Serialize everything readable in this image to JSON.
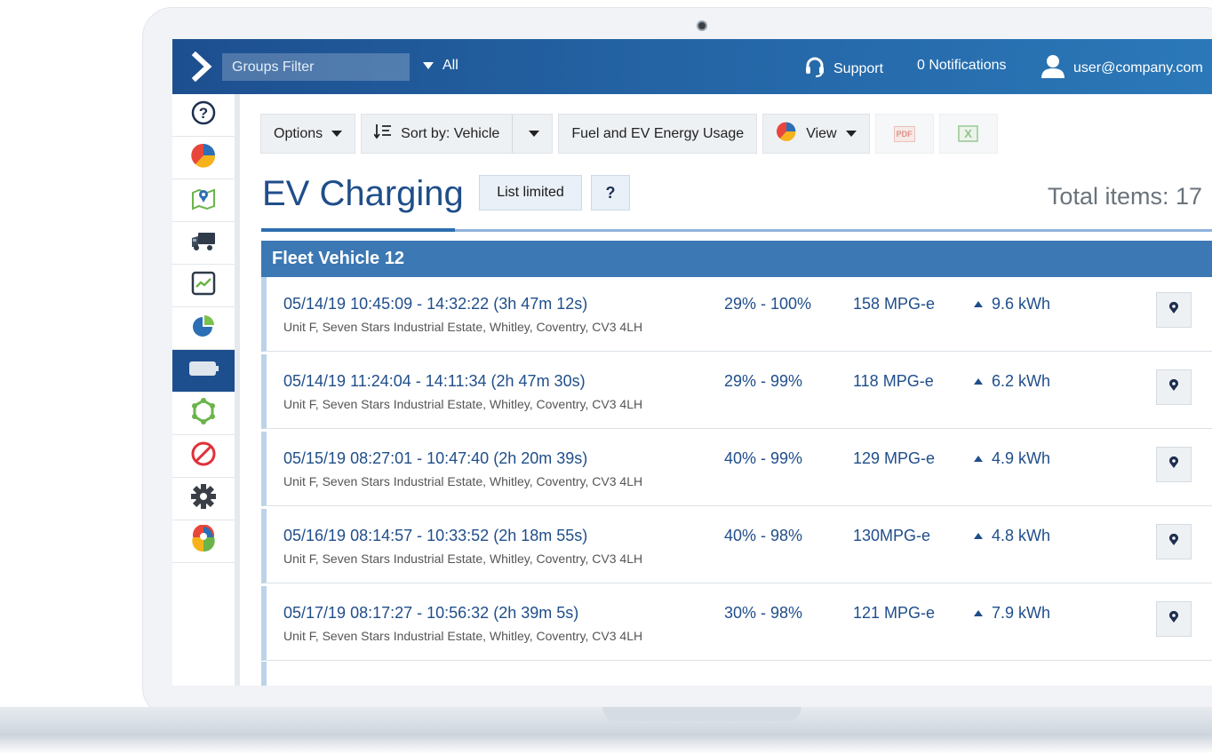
{
  "topbar": {
    "groups_filter_placeholder": "Groups Filter",
    "all_label": "All",
    "support_label": "Support",
    "notifications_label": "0 Notifications",
    "user_label": "user@company.com"
  },
  "sidebar": {
    "items": [
      {
        "icon": "help-circle-icon"
      },
      {
        "icon": "pie-chart-icon"
      },
      {
        "icon": "map-icon"
      },
      {
        "icon": "truck-icon"
      },
      {
        "icon": "trend-chart-icon"
      },
      {
        "icon": "radar-chart-icon"
      },
      {
        "icon": "ev-battery-icon",
        "active": true
      },
      {
        "icon": "zone-icon"
      },
      {
        "icon": "prohibited-icon"
      },
      {
        "icon": "settings-gear-icon"
      },
      {
        "icon": "marketplace-pin-icon"
      }
    ]
  },
  "toolbar": {
    "options_label": "Options",
    "sort_label": "Sort by: Vehicle",
    "fuel_label": "Fuel and EV Energy Usage",
    "view_label": "View",
    "pdf_label": "PDF",
    "excel_label": "X"
  },
  "page": {
    "title": "EV Charging",
    "list_limited_label": "List limited",
    "help_label": "?",
    "total_items": "Total items: 17"
  },
  "group": {
    "name": "Fleet Vehicle 12"
  },
  "rows": [
    {
      "when": "05/14/19 10:45:09 - 14:32:22 (3h 47m 12s)",
      "address": "Unit F, Seven Stars Industrial Estate, Whitley, Coventry, CV3 4LH",
      "soc": "29% - 100%",
      "mpg": "158 MPG-e",
      "kwh": "9.6 kWh"
    },
    {
      "when": "05/14/19 11:24:04 - 14:11:34 (2h 47m 30s)",
      "address": "Unit F, Seven Stars Industrial Estate, Whitley, Coventry, CV3 4LH",
      "soc": "29% - 99%",
      "mpg": "118 MPG-e",
      "kwh": "6.2 kWh"
    },
    {
      "when": "05/15/19 08:27:01 - 10:47:40 (2h 20m 39s)",
      "address": "Unit F, Seven Stars Industrial Estate, Whitley, Coventry, CV3 4LH",
      "soc": "40% - 99%",
      "mpg": "129 MPG-e",
      "kwh": "4.9 kWh"
    },
    {
      "when": "05/16/19 08:14:57 - 10:33:52 (2h 18m 55s)",
      "address": "Unit F, Seven Stars Industrial Estate, Whitley, Coventry, CV3 4LH",
      "soc": "40% - 98%",
      "mpg": "130MPG-e",
      "kwh": "4.8 kWh"
    },
    {
      "when": "05/17/19 08:17:27 - 10:56:32 (2h 39m 5s)",
      "address": "Unit F, Seven Stars Industrial Estate, Whitley, Coventry, CV3 4LH",
      "soc": "30% - 98%",
      "mpg": "121 MPG-e",
      "kwh": "7.9 kWh"
    }
  ],
  "colors": {
    "brand_blue": "#1d4f8f",
    "group_header": "#3c78b4",
    "text_blue": "#1f4e8a"
  }
}
